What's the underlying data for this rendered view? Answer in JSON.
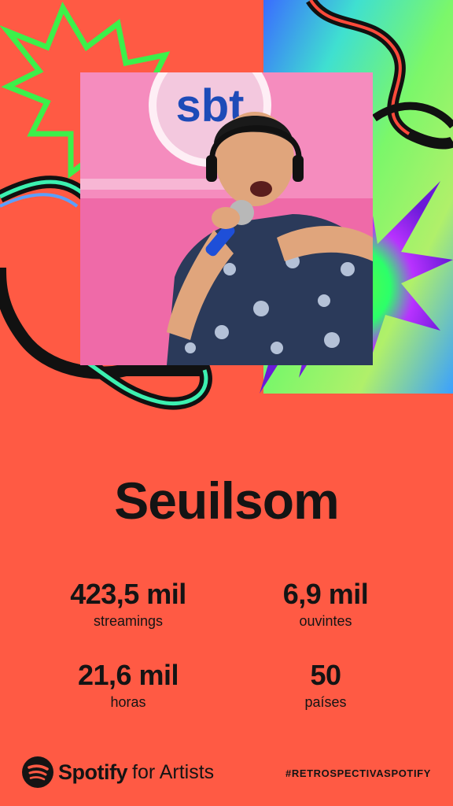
{
  "artist": {
    "name": "Seuilsom"
  },
  "photo": {
    "logo_text": "sbt"
  },
  "stats": [
    {
      "value": "423,5 mil",
      "label": "streamings"
    },
    {
      "value": "6,9 mil",
      "label": "ouvintes"
    },
    {
      "value": "21,6 mil",
      "label": "horas"
    },
    {
      "value": "50",
      "label": "países"
    }
  ],
  "footer": {
    "brand_word": "Spotify",
    "brand_suffix": "for Artists",
    "hashtag": "#RETROSPECTIVASPOTIFY"
  },
  "colors": {
    "background": "#ff5a44",
    "text": "#141414",
    "accent_green": "#3cf04a",
    "accent_purple": "#8a2be2"
  },
  "icons": [
    "spotify-logo-icon"
  ]
}
